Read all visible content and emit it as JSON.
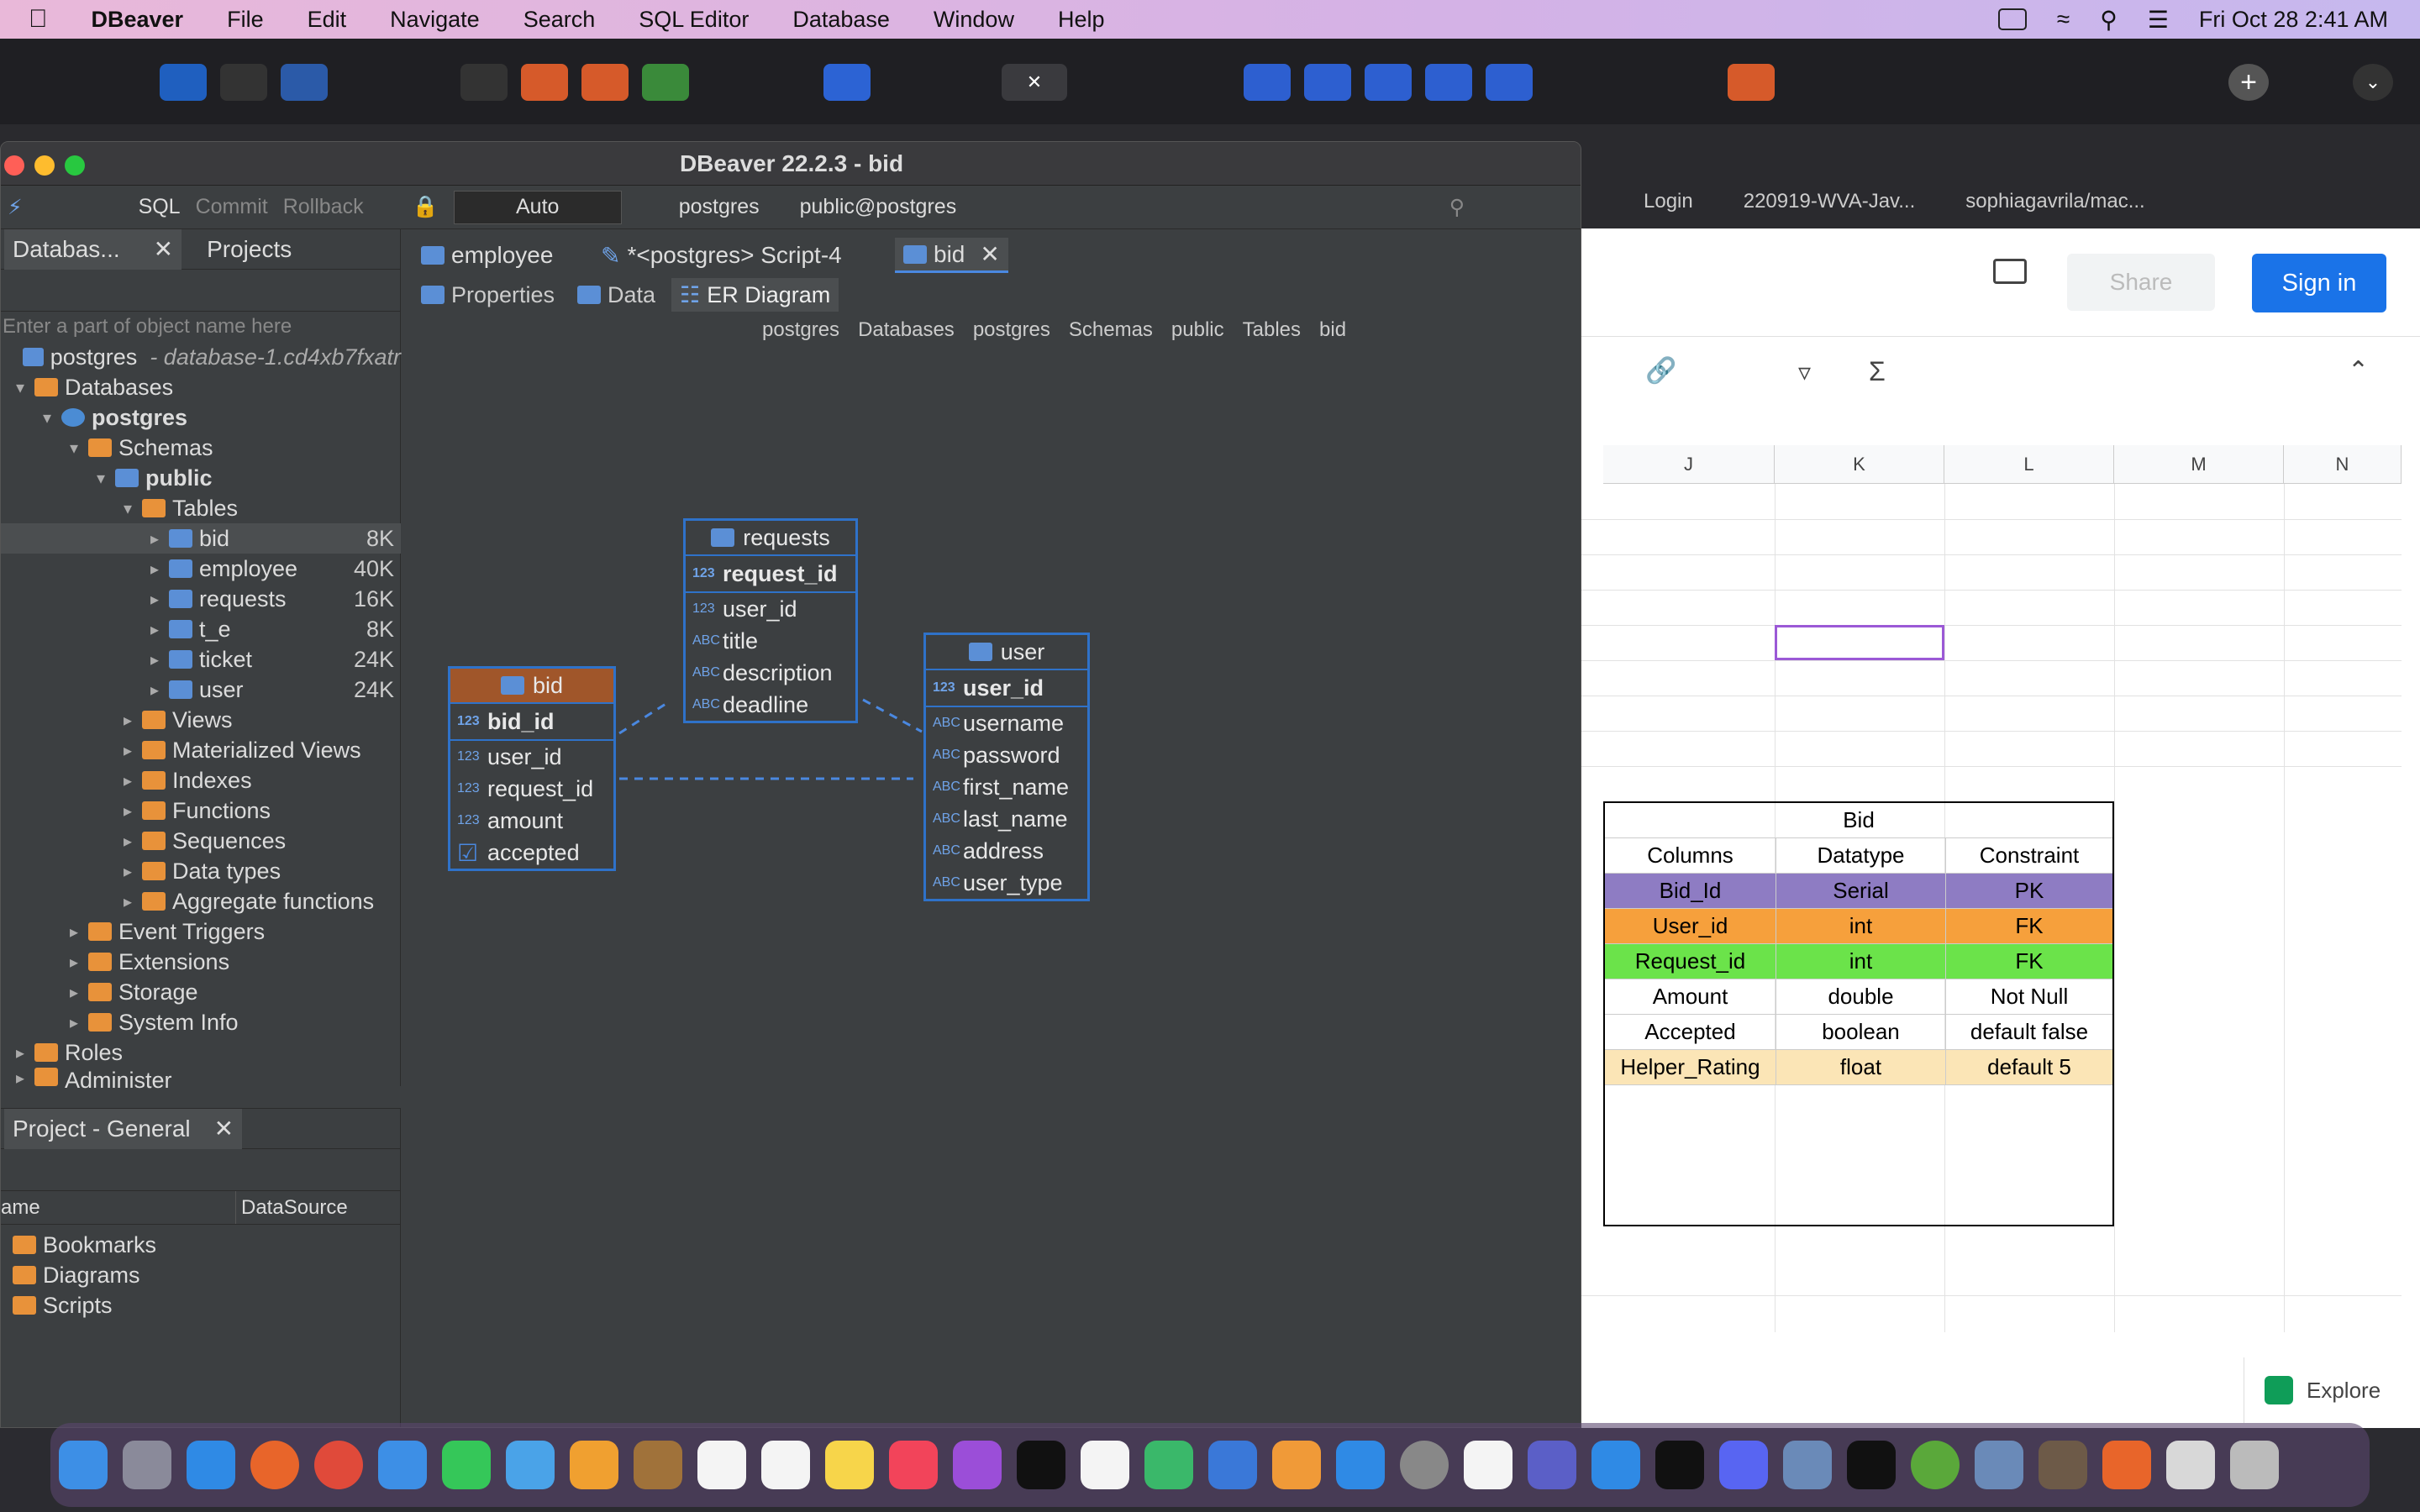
{
  "menubar": {
    "app": "DBeaver",
    "items": [
      "File",
      "Edit",
      "Navigate",
      "Search",
      "SQL Editor",
      "Database",
      "Window",
      "Help"
    ],
    "clock": "Fri Oct 28  2:41 AM"
  },
  "window": {
    "title": "DBeaver 22.2.3 - bid"
  },
  "toolbar": {
    "sql": "SQL",
    "commit": "Commit",
    "rollback": "Rollback",
    "mode": "Auto",
    "datasource": "postgres",
    "schema": "public@postgres"
  },
  "nav": {
    "tab_db": "Databas...",
    "tab_projects": "Projects",
    "filter_placeholder": "Enter a part of object name here",
    "conn_name": "postgres",
    "conn_desc": "- database-1.cd4xb7fxatr",
    "tree": [
      {
        "label": "Databases"
      },
      {
        "label": "postgres"
      },
      {
        "label": "Schemas"
      },
      {
        "label": "public"
      },
      {
        "label": "Tables"
      },
      {
        "label": "bid",
        "size": "8K"
      },
      {
        "label": "employee",
        "size": "40K"
      },
      {
        "label": "requests",
        "size": "16K"
      },
      {
        "label": "t_e",
        "size": "8K"
      },
      {
        "label": "ticket",
        "size": "24K"
      },
      {
        "label": "user",
        "size": "24K"
      },
      {
        "label": "Views"
      },
      {
        "label": "Materialized Views"
      },
      {
        "label": "Indexes"
      },
      {
        "label": "Functions"
      },
      {
        "label": "Sequences"
      },
      {
        "label": "Data types"
      },
      {
        "label": "Aggregate functions"
      },
      {
        "label": "Event Triggers"
      },
      {
        "label": "Extensions"
      },
      {
        "label": "Storage"
      },
      {
        "label": "System Info"
      },
      {
        "label": "Roles"
      },
      {
        "label": "Administer"
      }
    ]
  },
  "project": {
    "title": "Project - General",
    "col_name": "ame",
    "col_ds": "DataSource",
    "items": [
      "Bookmarks",
      "Diagrams",
      "Scripts"
    ]
  },
  "editor": {
    "tabs": [
      "employee",
      "*<postgres> Script-4",
      "bid"
    ],
    "subtabs": [
      "Properties",
      "Data",
      "ER Diagram"
    ],
    "breadcrumb": [
      "postgres",
      "Databases",
      "postgres",
      "Schemas",
      "public",
      "Tables",
      "bid"
    ]
  },
  "er": {
    "requests": {
      "name": "requests",
      "pk": "request_id",
      "cols": [
        {
          "t": "123",
          "n": "user_id"
        },
        {
          "t": "ABC",
          "n": "title"
        },
        {
          "t": "ABC",
          "n": "description"
        },
        {
          "t": "ABC",
          "n": "deadline"
        }
      ]
    },
    "bid": {
      "name": "bid",
      "pk": "bid_id",
      "cols": [
        {
          "t": "123",
          "n": "user_id"
        },
        {
          "t": "123",
          "n": "request_id"
        },
        {
          "t": "123",
          "n": "amount"
        },
        {
          "t": "chk",
          "n": "accepted"
        }
      ]
    },
    "user": {
      "name": "user",
      "pk": "user_id",
      "cols": [
        {
          "t": "ABC",
          "n": "username"
        },
        {
          "t": "ABC",
          "n": "password"
        },
        {
          "t": "ABC",
          "n": "first_name"
        },
        {
          "t": "ABC",
          "n": "last_name"
        },
        {
          "t": "ABC",
          "n": "address"
        },
        {
          "t": "ABC",
          "n": "user_type"
        }
      ]
    }
  },
  "browser": {
    "tabs": [
      "Login",
      "220919-WVA-Jav...",
      "sophiagavrila/mac..."
    ],
    "share": "Share",
    "signin": "Sign in",
    "explore": "Explore"
  },
  "sheet": {
    "cols": [
      "J",
      "K",
      "L",
      "M",
      "N"
    ],
    "table_title": "Bid",
    "headers": [
      "Columns",
      "Datatype",
      "Constraint"
    ],
    "rows": [
      {
        "c": [
          "Bid_Id",
          "Serial",
          "PK"
        ],
        "bg": "#8e7cc3"
      },
      {
        "c": [
          "User_id",
          "int",
          "FK"
        ],
        "bg": "#f6a03c"
      },
      {
        "c": [
          "Request_id",
          "int",
          "FK"
        ],
        "bg": "#6be34a"
      },
      {
        "c": [
          "Amount",
          "double",
          "Not Null"
        ],
        "bg": "#ffffff"
      },
      {
        "c": [
          "Accepted",
          "boolean",
          "default false"
        ],
        "bg": "#ffffff"
      },
      {
        "c": [
          "Helper_Rating",
          "float",
          "default 5"
        ],
        "bg": "#fbe5b6"
      }
    ]
  }
}
